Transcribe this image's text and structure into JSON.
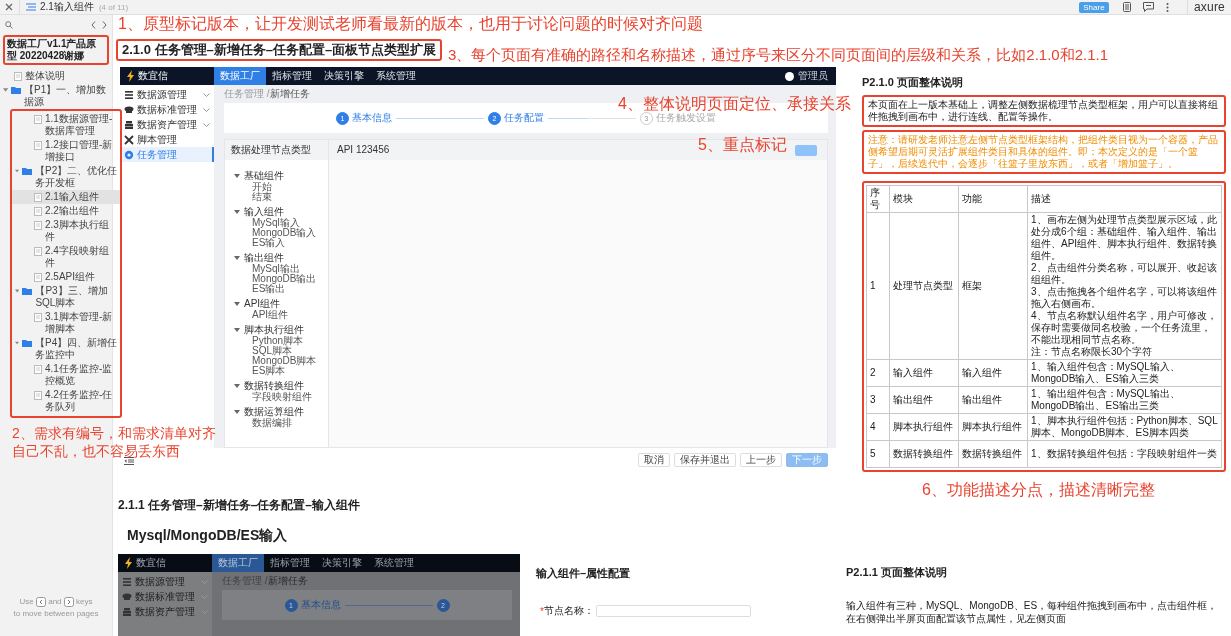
{
  "topbar": {
    "page_title": "2.1输入组件",
    "page_count": "(4 of 11)",
    "share": "Share",
    "brand": "axure"
  },
  "sidebar": {
    "project_title": "数据工厂v1.1产品原型 20220428谢娜",
    "pages": [
      {
        "label": "整体说明",
        "kind": "page",
        "selected": false
      },
      {
        "label": "【P1】一、增加数据源",
        "kind": "folder",
        "expanded": true,
        "selected": false,
        "children": [
          {
            "label": "1.1数据源管理-数据库管理",
            "kind": "page",
            "selected": false
          },
          {
            "label": "1.2接口管理-新增接口",
            "kind": "page",
            "selected": false
          }
        ]
      },
      {
        "label": "【P2】二、优化任务开发框",
        "kind": "folder",
        "expanded": true,
        "selected": false,
        "children": [
          {
            "label": "2.1输入组件",
            "kind": "page",
            "selected": true
          },
          {
            "label": "2.2输出组件",
            "kind": "page",
            "selected": false
          },
          {
            "label": "2.3脚本执行组件",
            "kind": "page",
            "selected": false
          },
          {
            "label": "2.4字段映射组件",
            "kind": "page",
            "selected": false
          },
          {
            "label": "2.5API组件",
            "kind": "page",
            "selected": false
          }
        ]
      },
      {
        "label": "【P3】三、增加SQL脚本",
        "kind": "folder",
        "expanded": true,
        "selected": false,
        "children": [
          {
            "label": "3.1脚本管理-新增脚本",
            "kind": "page",
            "selected": false
          }
        ]
      },
      {
        "label": "【P4】四、新增任务监控中",
        "kind": "folder",
        "expanded": true,
        "selected": false,
        "children": [
          {
            "label": "4.1任务监控-监控概览",
            "kind": "page",
            "selected": false
          },
          {
            "label": "4.2任务监控-任务队列",
            "kind": "page",
            "selected": false
          }
        ]
      }
    ],
    "hint": {
      "before": "Use",
      "middle": "and",
      "after": "keys",
      "line2": "to move between pages"
    }
  },
  "annotations": [
    {
      "text": "1、原型标记版本，让开发测试老师看最新的版本，也用于讨论问题的时候对齐问题"
    },
    {
      "text": "2、需求有编号，和需求清单对齐自己不乱，也不容易丢东西"
    },
    {
      "text": "3、每个页面有准确的路径和名称描述，通过序号来区分不同页面间的层级和关系，比如2.1.0和2.1.1"
    },
    {
      "text": "4、整体说明页面定位、承接关系"
    },
    {
      "text": "5、重点标记"
    },
    {
      "text": "6、功能描述分点，描述清晰完整"
    }
  ],
  "section_210": {
    "heading": "2.1.0 任务管理–新增任务–任务配置–面板节点类型扩展",
    "prototype": {
      "logo": "数宜信",
      "tabs": [
        {
          "label": "数据工厂",
          "selected": true
        },
        {
          "label": "指标管理",
          "selected": false
        },
        {
          "label": "决策引擎",
          "selected": false
        },
        {
          "label": "系统管理",
          "selected": false
        }
      ],
      "user": "管理员",
      "menu": [
        {
          "label": "数据源管理",
          "kind": "group",
          "selected": false
        },
        {
          "label": "数据标准管理",
          "kind": "group",
          "selected": false
        },
        {
          "label": "数据资产管理",
          "kind": "group",
          "selected": false
        },
        {
          "label": "脚本管理",
          "kind": "link",
          "selected": false
        },
        {
          "label": "任务管理",
          "kind": "link",
          "selected": true
        }
      ],
      "breadcrumb": [
        "任务管理",
        "新增任务"
      ],
      "breadcrumb_separator": "/",
      "steps": [
        {
          "number": "1",
          "label": "基本信息",
          "active": true
        },
        {
          "number": "2",
          "label": "任务配置",
          "active": true
        },
        {
          "number": "3",
          "label": "任务触发设置",
          "active": false
        }
      ],
      "panel": {
        "header_left": "数据处理节点类型",
        "header_right": "API 123456",
        "groups": [
          {
            "label": "基础组件",
            "expanded": true,
            "items": [
              "开始",
              "结束"
            ]
          },
          {
            "label": "输入组件",
            "expanded": true,
            "items": [
              "MySql输入",
              "MongoDB输入",
              "ES输入"
            ]
          },
          {
            "label": "输出组件",
            "expanded": true,
            "items": [
              "MySql输出",
              "MongoDB输出",
              "ES输出"
            ]
          },
          {
            "label": "API组件",
            "expanded": true,
            "items": [
              "API组件"
            ]
          },
          {
            "label": "脚本执行组件",
            "expanded": true,
            "items": [
              "Python脚本",
              "SQL脚本",
              "MongoDB脚本",
              "ES脚本"
            ]
          },
          {
            "label": "数据转换组件",
            "expanded": true,
            "items": [
              "字段映射组件"
            ]
          },
          {
            "label": "数据运算组件",
            "expanded": true,
            "items": [
              "数据编排"
            ]
          }
        ]
      }
    },
    "footer_buttons": [
      {
        "label": "取消",
        "kind": "default",
        "disabled": false
      },
      {
        "label": "保存并退出",
        "kind": "default",
        "disabled": false
      },
      {
        "label": "上一步",
        "kind": "default",
        "disabled": false
      },
      {
        "label": "下一步",
        "kind": "primary",
        "disabled": true
      }
    ],
    "overview": {
      "title": "P2.1.0 页面整体说明",
      "summary": "本页面在上一版本基础上，调整左侧数据梳理节点类型框架，用户可以直接将组件拖拽到画布中，进行连线、配置等操作。",
      "note": "注意：请研发老师注意左侧节点类型框架结构，把组件类目视为一个容器，产品侧希望后期可灵活扩展组件类目和具体的组件。即：本次定义的是「一个篮子」，后续迭代中，会逐步「往篮子里放东西」，或者「增加篮子」。"
    },
    "table": {
      "columns": [
        "序号",
        "模块",
        "功能",
        "描述"
      ],
      "rows": [
        {
          "cells": [
            "1",
            "处理节点类型",
            "框架"
          ],
          "description": [
            "1、画布左侧为处理节点类型展示区域，此处分成6个组：基础组件、输入组件、输出组件、API组件、脚本执行组件、数据转换组件。",
            "2、点击组件分类名称，可以展开、收起该组组件。",
            "3、点击拖拽各个组件名字，可以将该组件拖入右侧画布。",
            "4、节点名称默认组件名字，用户可修改，保存时需要做同名校验，一个任务流里，不能出现相同节点名称。",
            "注：节点名称限长30个字符"
          ]
        },
        {
          "cells": [
            "2",
            "输入组件",
            "输入组件"
          ],
          "description": [
            "1、输入组件包含：MySQL输入、MongoDB输入、ES输入三类"
          ]
        },
        {
          "cells": [
            "3",
            "输出组件",
            "输出组件"
          ],
          "description": [
            "1、输出组件包含：MySQL输出、MongoDB输出、ES输出三类"
          ]
        },
        {
          "cells": [
            "4",
            "脚本执行组件",
            "脚本执行组件"
          ],
          "description": [
            "1、脚本执行组件包括：Python脚本、SQL脚本、MongoDB脚本、ES脚本四类"
          ]
        },
        {
          "cells": [
            "5",
            "数据转换组件",
            "数据转换组件"
          ],
          "description": [
            "1、数据转换组件包括：字段映射组件一类"
          ]
        }
      ]
    }
  },
  "section_211": {
    "heading": "2.1.1 任务管理–新增任务–任务配置–输入组件",
    "subheading": "Mysql/MongoDB/ES输入",
    "prototype": {
      "logo": "数宜信",
      "dimmed": true,
      "tabs": [
        {
          "label": "数据工厂",
          "selected": true
        },
        {
          "label": "指标管理",
          "selected": false
        },
        {
          "label": "决策引擎",
          "selected": false
        },
        {
          "label": "系统管理",
          "selected": false
        }
      ],
      "menu": [
        {
          "label": "数据源管理",
          "kind": "group",
          "selected": false
        },
        {
          "label": "数据标准管理",
          "kind": "group",
          "selected": false
        },
        {
          "label": "数据资产管理",
          "kind": "group",
          "selected": false
        }
      ],
      "breadcrumb": [
        "任务管理",
        "新增任务"
      ],
      "breadcrumb_separator": "/",
      "steps": [
        {
          "number": "1",
          "label": "基本信息",
          "active": true
        },
        {
          "number": "2",
          "active": true
        }
      ]
    },
    "form_title": "输入组件–属性配置",
    "field": {
      "required_mark": "*",
      "label": "节点名称："
    },
    "overview": {
      "title": "P2.1.1 页面整体说明",
      "text": "输入组件有三种，MySQL、MongoDB、ES，每种组件拖拽到画布中，点击组件框，在右侧弹出半屏页面配置该节点属性，见左侧页面"
    }
  }
}
